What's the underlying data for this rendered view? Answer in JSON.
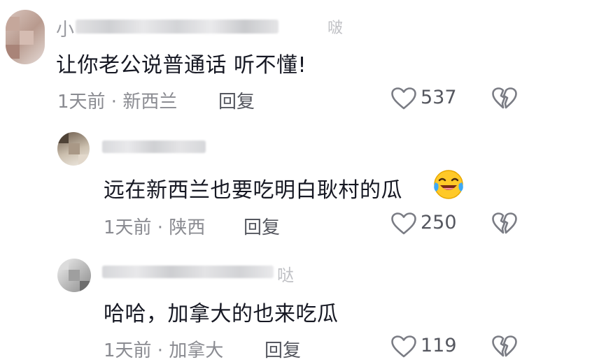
{
  "comments": [
    {
      "text": "让你老公说普通话 听不懂!",
      "meta": "1天前 · 新西兰",
      "reply": "回复",
      "likes": "537",
      "username_tail": "啵"
    },
    {
      "text": "远在新西兰也要吃明白耿村的瓜",
      "meta": "1天前 · 陕西",
      "reply": "回复",
      "likes": "250",
      "username_tail": ""
    },
    {
      "text": "哈哈，加拿大的也来吃瓜",
      "meta": "1天前 · 加拿大",
      "reply": "回复",
      "likes": "119",
      "username_tail": "哒"
    }
  ],
  "colors": {
    "text": "#161823",
    "meta": "#8a8b91",
    "icon": "#7a7c84"
  },
  "icons": {
    "like": "heart-outline-icon",
    "dislike": "broken-heart-icon",
    "emoji": "laughing-tears-emoji"
  }
}
